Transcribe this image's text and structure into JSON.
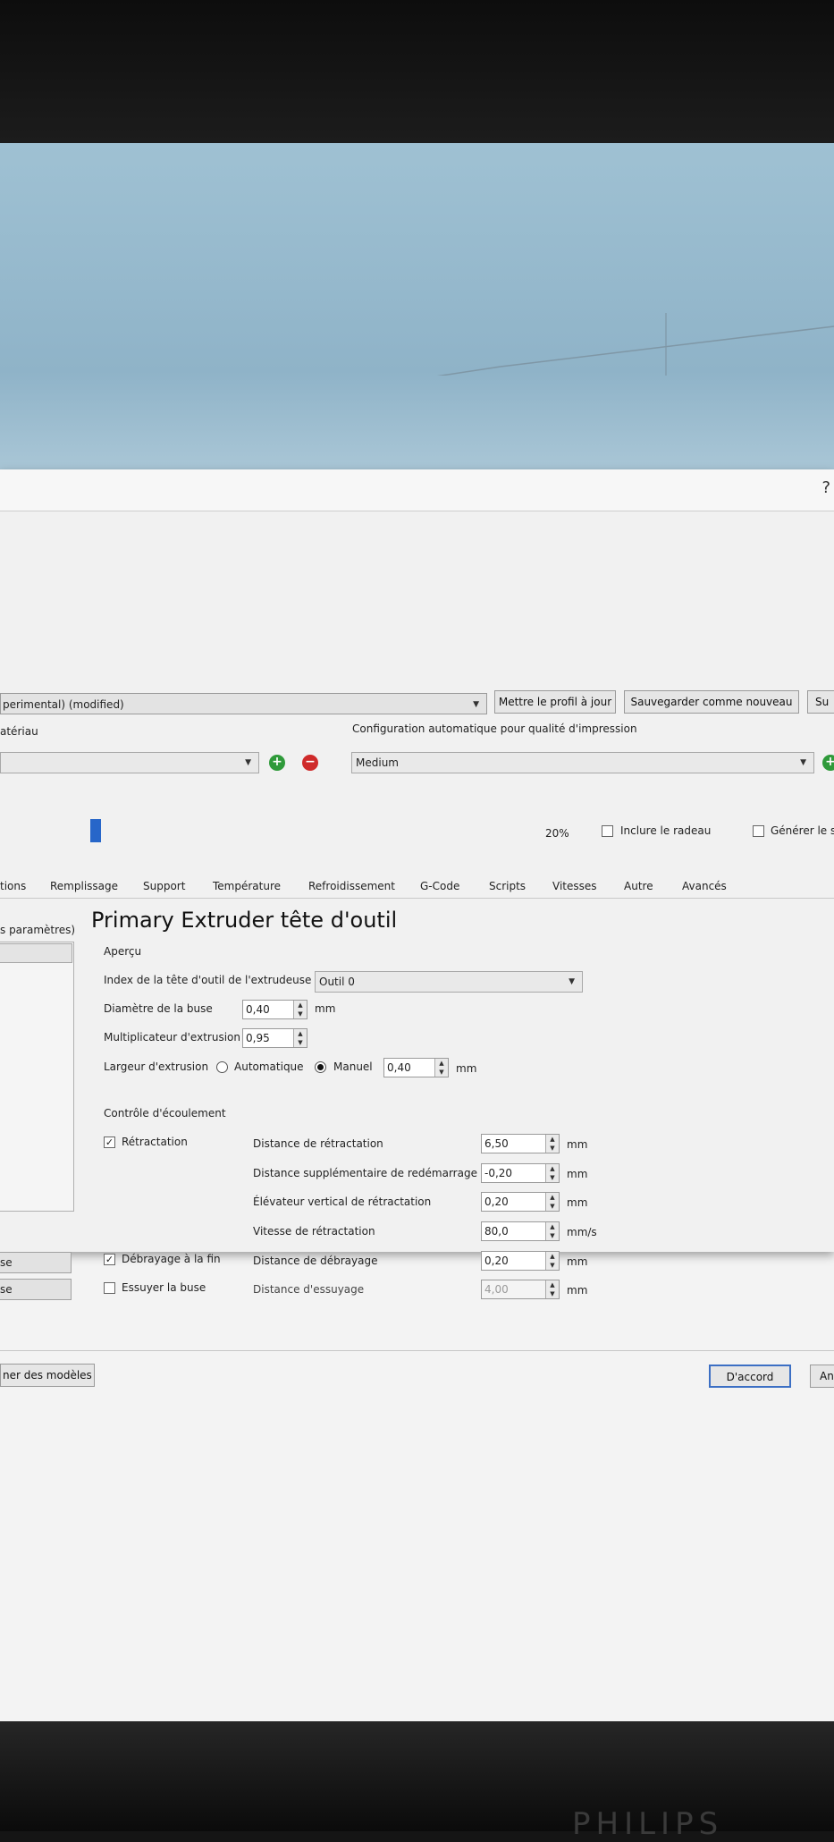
{
  "dialog": {
    "help": "?",
    "profile": {
      "value": "perimental) (modified)",
      "update_button": "Mettre le profil à jour",
      "save_new_button": "Sauvegarder comme nouveau",
      "more_button": "Su"
    },
    "material_label": "atériau",
    "auto_config_label": "Configuration automatique pour qualité d'impression",
    "quality_value": "Medium",
    "infill_percent": "20%",
    "raft_label": "Inclure le radeau",
    "generate_label": "Générer le s",
    "tabs": [
      "tions",
      "Remplissage",
      "Support",
      "Température",
      "Refroidissement",
      "G-Code",
      "Scripts",
      "Vitesses",
      "Autre",
      "Avancés"
    ],
    "left_header": "s paramètres)",
    "left_buttons": [
      "se",
      "se"
    ],
    "section_title": "Primary Extruder tête d'outil",
    "apercu": {
      "title": "Aperçu",
      "tool_index_label": "Index de la tête d'outil de l'extrudeuse",
      "tool_index_value": "Outil 0",
      "nozzle_label": "Diamètre de la buse",
      "nozzle_value": "0,40",
      "nozzle_unit": "mm",
      "multiplier_label": "Multiplicateur d'extrusion",
      "multiplier_value": "0,95",
      "width_label": "Largeur d'extrusion",
      "auto_label": "Automatique",
      "manual_label": "Manuel",
      "width_value": "0,40",
      "width_unit": "mm"
    },
    "flow": {
      "title": "Contrôle d'écoulement",
      "retraction_label": "Rétractation",
      "retraction_distance_label": "Distance de rétractation",
      "retraction_distance_value": "6,50",
      "extra_restart_label": "Distance supplémentaire de redémarrage",
      "extra_restart_value": "-0,20",
      "vertical_lift_label": "Élévateur vertical de rétractation",
      "vertical_lift_value": "0,20",
      "retraction_speed_label": "Vitesse de rétractation",
      "retraction_speed_value": "80,0",
      "coast_label": "Débrayage à la fin",
      "coast_distance_label": "Distance de débrayage",
      "coast_distance_value": "0,20",
      "wipe_label": "Essuyer la buse",
      "wipe_distance_label": "Distance d'essuyage",
      "wipe_distance_value": "4,00",
      "unit_mm": "mm",
      "unit_mms": "mm/s"
    },
    "footer": {
      "models_button": "ner des modèles",
      "ok_button": "D'accord",
      "other_button": "An"
    }
  },
  "monitor": {
    "brand": "PHILIPS"
  }
}
